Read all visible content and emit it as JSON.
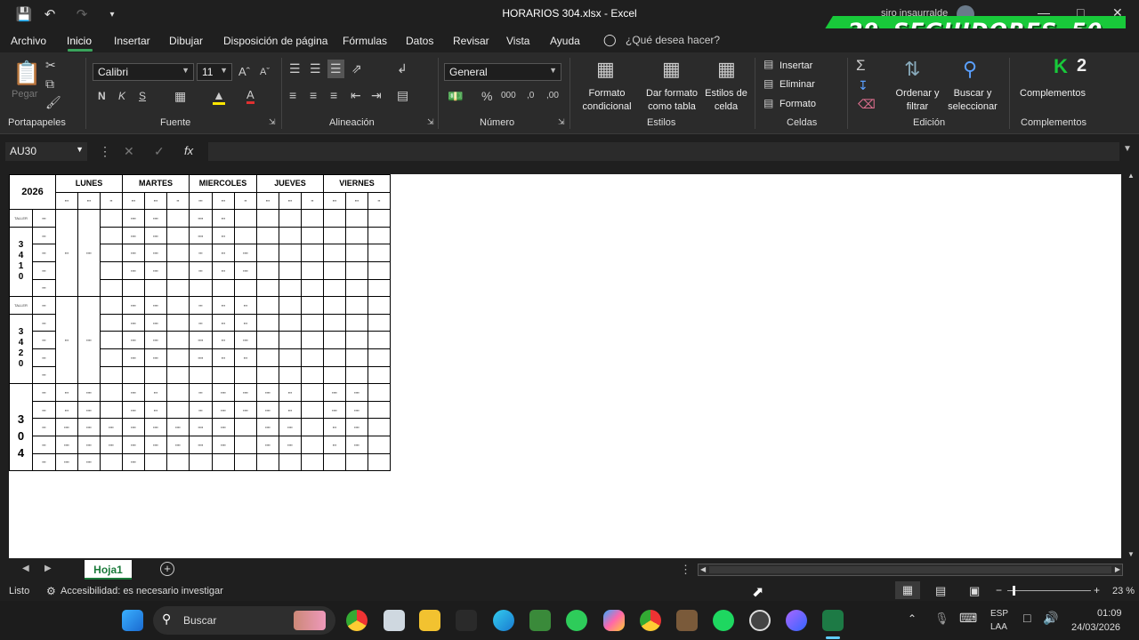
{
  "window": {
    "title": "HORARIOS 304.xlsx  -  Excel",
    "user": "siro insaurralde"
  },
  "banner": {
    "left": "29",
    "middle": "SEGUIDORES",
    "right": "50"
  },
  "menu": {
    "items": [
      "Archivo",
      "Inicio",
      "Insertar",
      "Dibujar",
      "Disposición de página",
      "Fórmulas",
      "Datos",
      "Revisar",
      "Vista",
      "Ayuda"
    ],
    "tellme": "¿Qué desea hacer?"
  },
  "ribbon": {
    "paste": "Pegar",
    "font_name": "Calibri",
    "font_size": "11",
    "number_format": "General",
    "conditional_format": "Formato condicional",
    "format_table": "Dar formato como tabla",
    "cell_styles": "Estilos de celda",
    "insert": "Insertar",
    "delete": "Eliminar",
    "format": "Formato",
    "sort_filter": "Ordenar y filtrar",
    "find_select": "Buscar y seleccionar",
    "addins": "Complementos",
    "k_badge": "2",
    "groups": {
      "clipboard": "Portapapeles",
      "font": "Fuente",
      "alignment": "Alineación",
      "number": "Número",
      "styles": "Estilos",
      "cells": "Celdas",
      "editing": "Edición",
      "addins": "Complementos"
    }
  },
  "formula_bar": {
    "name_box": "AU30",
    "fx": "fx"
  },
  "schedule": {
    "year": "2026",
    "days": [
      "LUNES",
      "MARTES",
      "MIERCOLES",
      "JUEVES",
      "VIERNES"
    ],
    "taller": "TALLER",
    "course_3410": [
      "3",
      "4",
      "1",
      "0"
    ],
    "course_3420": [
      "3",
      "4",
      "2",
      "0"
    ],
    "course_304": [
      "3",
      "0",
      "4"
    ]
  },
  "sheet_tab": "Hoja1",
  "status": {
    "ready": "Listo",
    "accessibility": "Accesibilidad: es necesario investigar",
    "zoom": "23 %"
  },
  "taskbar": {
    "search": "Buscar",
    "lang1": "ESP",
    "lang2": "LAA",
    "time": "01:09",
    "date": "24/03/2026"
  }
}
